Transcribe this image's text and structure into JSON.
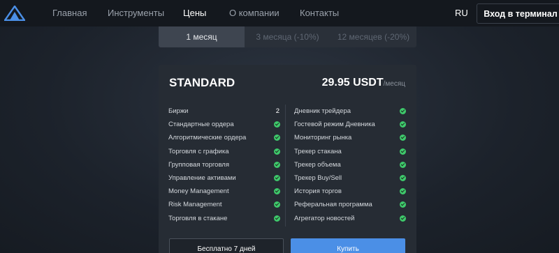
{
  "nav": {
    "items": [
      "Главная",
      "Инструменты",
      "Цены",
      "О компании",
      "Контакты"
    ],
    "active_index": 2,
    "lang": "RU",
    "terminal_button": "Вход в терминал"
  },
  "periods": {
    "tabs": [
      "1 месяц",
      "3 месяца (-10%)",
      "12 месяцев (-20%)"
    ],
    "active_index": 0
  },
  "plan": {
    "name": "STANDARD",
    "price": "29.95 USDT",
    "price_period": "/месяц",
    "left_features": [
      {
        "label": "Биржи",
        "value": "2"
      },
      {
        "label": "Стандартные ордера",
        "value": "check"
      },
      {
        "label": "Алгоритмические ордера",
        "value": "check"
      },
      {
        "label": "Торговля с графика",
        "value": "check"
      },
      {
        "label": "Групповая торговля",
        "value": "check"
      },
      {
        "label": "Управление активами",
        "value": "check"
      },
      {
        "label": "Money Management",
        "value": "check"
      },
      {
        "label": "Risk Management",
        "value": "check"
      },
      {
        "label": "Торговля в стакане",
        "value": "check"
      }
    ],
    "right_features": [
      {
        "label": "Дневник трейдера",
        "value": "check"
      },
      {
        "label": "Гостевой режим Дневника",
        "value": "check"
      },
      {
        "label": "Мониторинг рынка",
        "value": "check"
      },
      {
        "label": "Трекер стакана",
        "value": "check"
      },
      {
        "label": "Трекер объема",
        "value": "check"
      },
      {
        "label": "Трекер Buy/Sell",
        "value": "check"
      },
      {
        "label": "История торгов",
        "value": "check"
      },
      {
        "label": "Реферальная программа",
        "value": "check"
      },
      {
        "label": "Агрегатор новостей",
        "value": "check"
      }
    ]
  },
  "actions": {
    "free_trial": "Бесплатно 7 дней",
    "buy": "Купить"
  },
  "colors": {
    "accent": "#4b8fe6",
    "check": "#3ec96b",
    "topbar": "#14181e",
    "card": "#262c34"
  }
}
